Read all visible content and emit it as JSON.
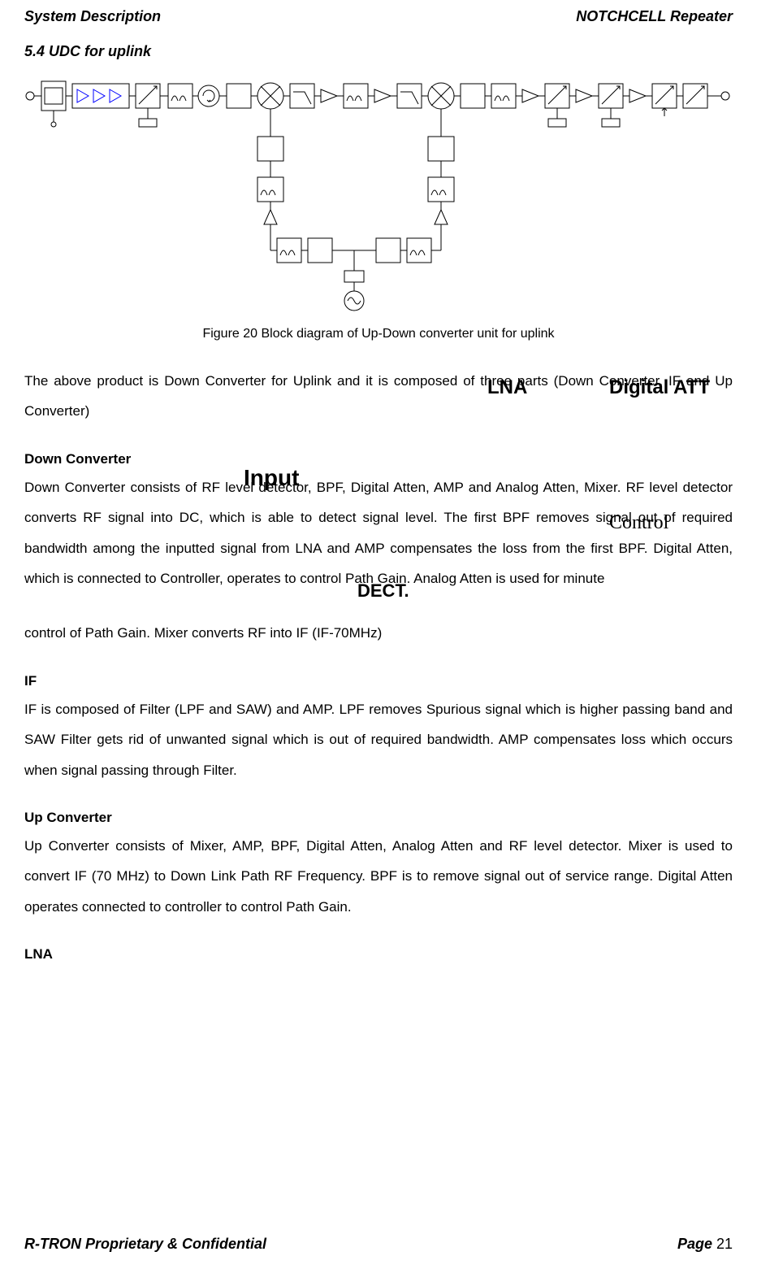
{
  "header": {
    "left": "System Description",
    "right": "NOTCHCELL Repeater"
  },
  "section_title": "5.4 UDC for uplink",
  "figure_caption": "Figure 20 Block diagram of Up-Down converter unit for uplink",
  "overlay": {
    "lna": "LNA",
    "digital_att": "Digital ATT",
    "input": "Input",
    "control": "Control",
    "dect": "DECT."
  },
  "p_intro": "The above product is Down Converter for Uplink and it is composed of three parts (Down Converter, IF and Up Converter)",
  "dc_head": "Down Converter",
  "dc_body_1": "Down Converter consists of RF level detector, BPF, Digital Atten, AMP and Analog Atten, Mixer. RF level detector converts RF signal into DC, which is able to detect signal level. The first BPF removes signal out of required bandwidth among the inputted signal from LNA and AMP compensates the loss from the first BPF. Digital Atten, which is connected to Controller, operates to control Path Gain. Analog Atten is used for minute",
  "dc_body_2": "control of Path Gain. Mixer converts RF into IF (IF-70MHz)",
  "if_head": "IF",
  "if_body": "IF is composed of Filter (LPF and SAW) and AMP. LPF removes Spurious signal which is higher passing band and SAW Filter gets rid of unwanted signal which is out of required bandwidth. AMP compensates loss which occurs when signal passing through Filter.",
  "uc_head": "Up Converter",
  "uc_body": "Up Converter consists of Mixer, AMP, BPF, Digital Atten, Analog Atten and RF level detector. Mixer is used to convert IF (70 MHz) to Down Link Path RF Frequency. BPF is to remove signal out of service range. Digital Atten operates connected to controller to control Path Gain.",
  "lna_head": "LNA",
  "footer": {
    "left": "R-TRON Proprietary & Confidential",
    "page_label": "Page ",
    "page_num": "21"
  }
}
